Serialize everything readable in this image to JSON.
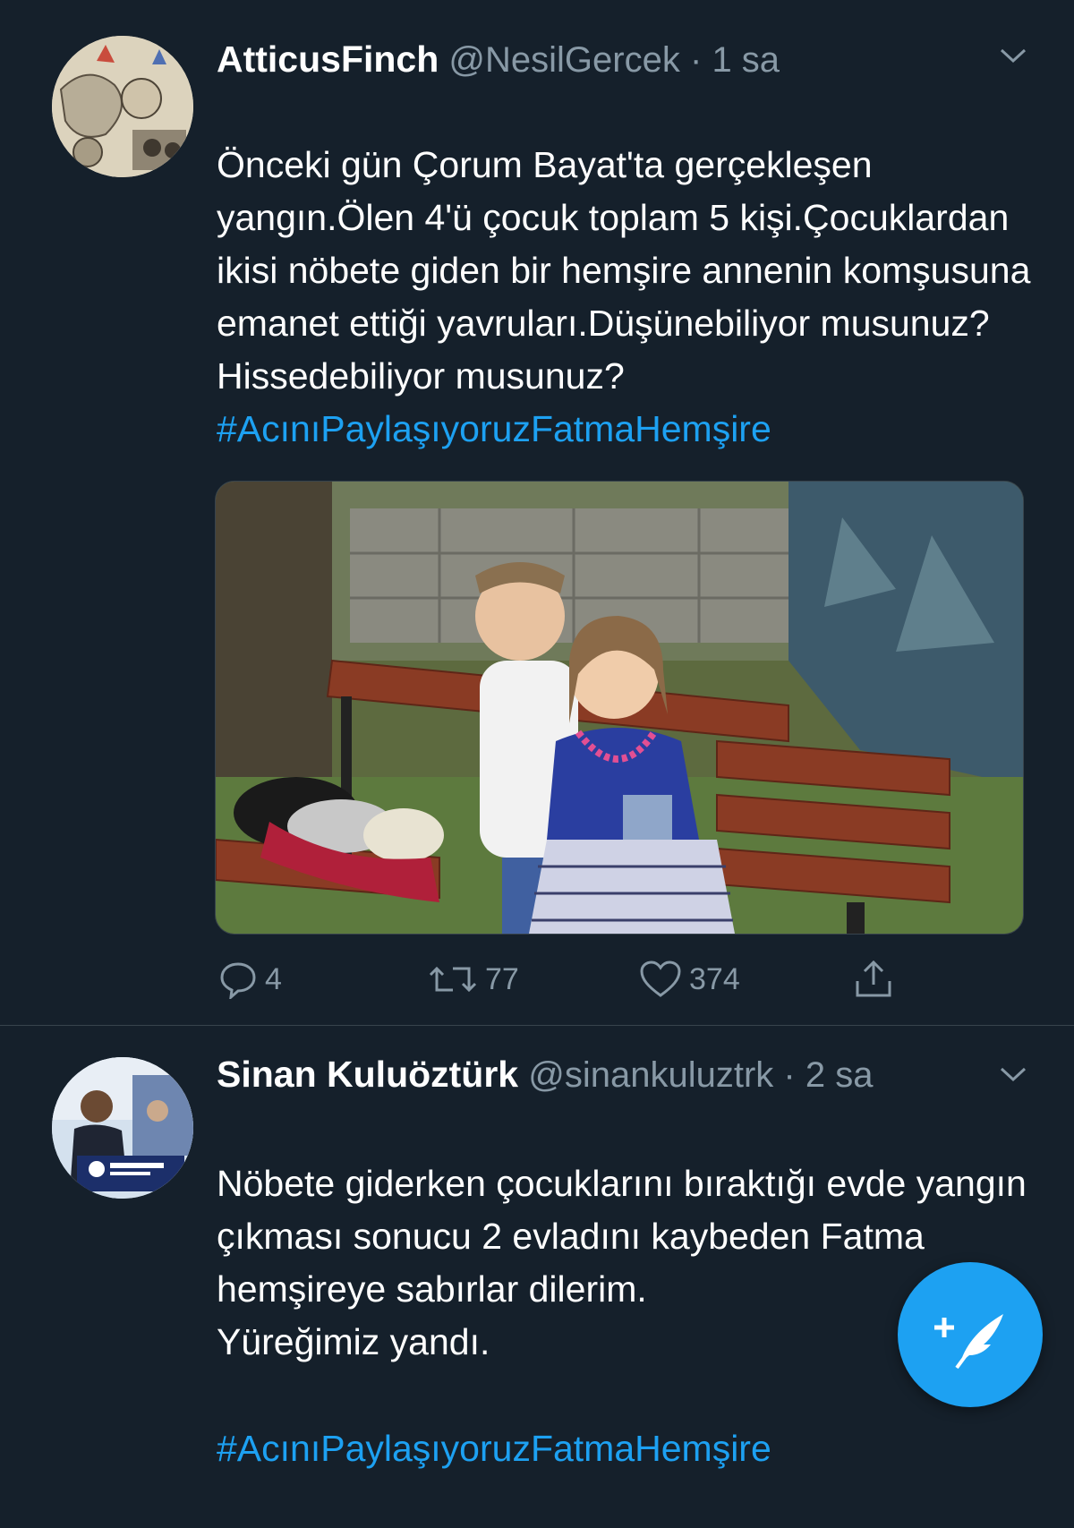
{
  "tweets": [
    {
      "name": "AtticusFinch",
      "handle": "@NesilGercek",
      "separator": "·",
      "time": "1 sa",
      "text": "Önceki gün Çorum Bayat'ta gerçekleşen yangın.Ölen 4'ü çocuk toplam 5 kişi.Çocuklardan ikisi nöbete giden bir hemşire annenin komşusuna emanet ettiği yavruları.Düşünebiliyor musunuz? Hissedebiliyor musunuz?",
      "hashtag": "#AcınıPaylaşıyoruzFatmaHemşire",
      "replies": "4",
      "retweets": "77",
      "likes": "374"
    },
    {
      "name": "Sinan Kuluöztürk",
      "handle": "@sinankuluztrk",
      "separator": "·",
      "time": "2 sa",
      "text": "Nöbete giderken çocuklarını bıraktığı evde yangın çıkması sonucu 2 evladını kaybeden Fatma hemşireye sabırlar dilerim.\nYüreğimiz yandı.",
      "hashtag": "#AcınıPaylaşıyoruzFatmaHemşire"
    }
  ],
  "colors": {
    "background": "#15202b",
    "text": "#ffffff",
    "secondary": "#8899a6",
    "accent": "#1da1f2",
    "divider": "#38444d"
  },
  "icons": {
    "reply": "reply-icon",
    "retweet": "retweet-icon",
    "like": "heart-icon",
    "share": "share-icon",
    "caret": "chevron-down-icon",
    "compose": "compose-tweet-icon"
  }
}
